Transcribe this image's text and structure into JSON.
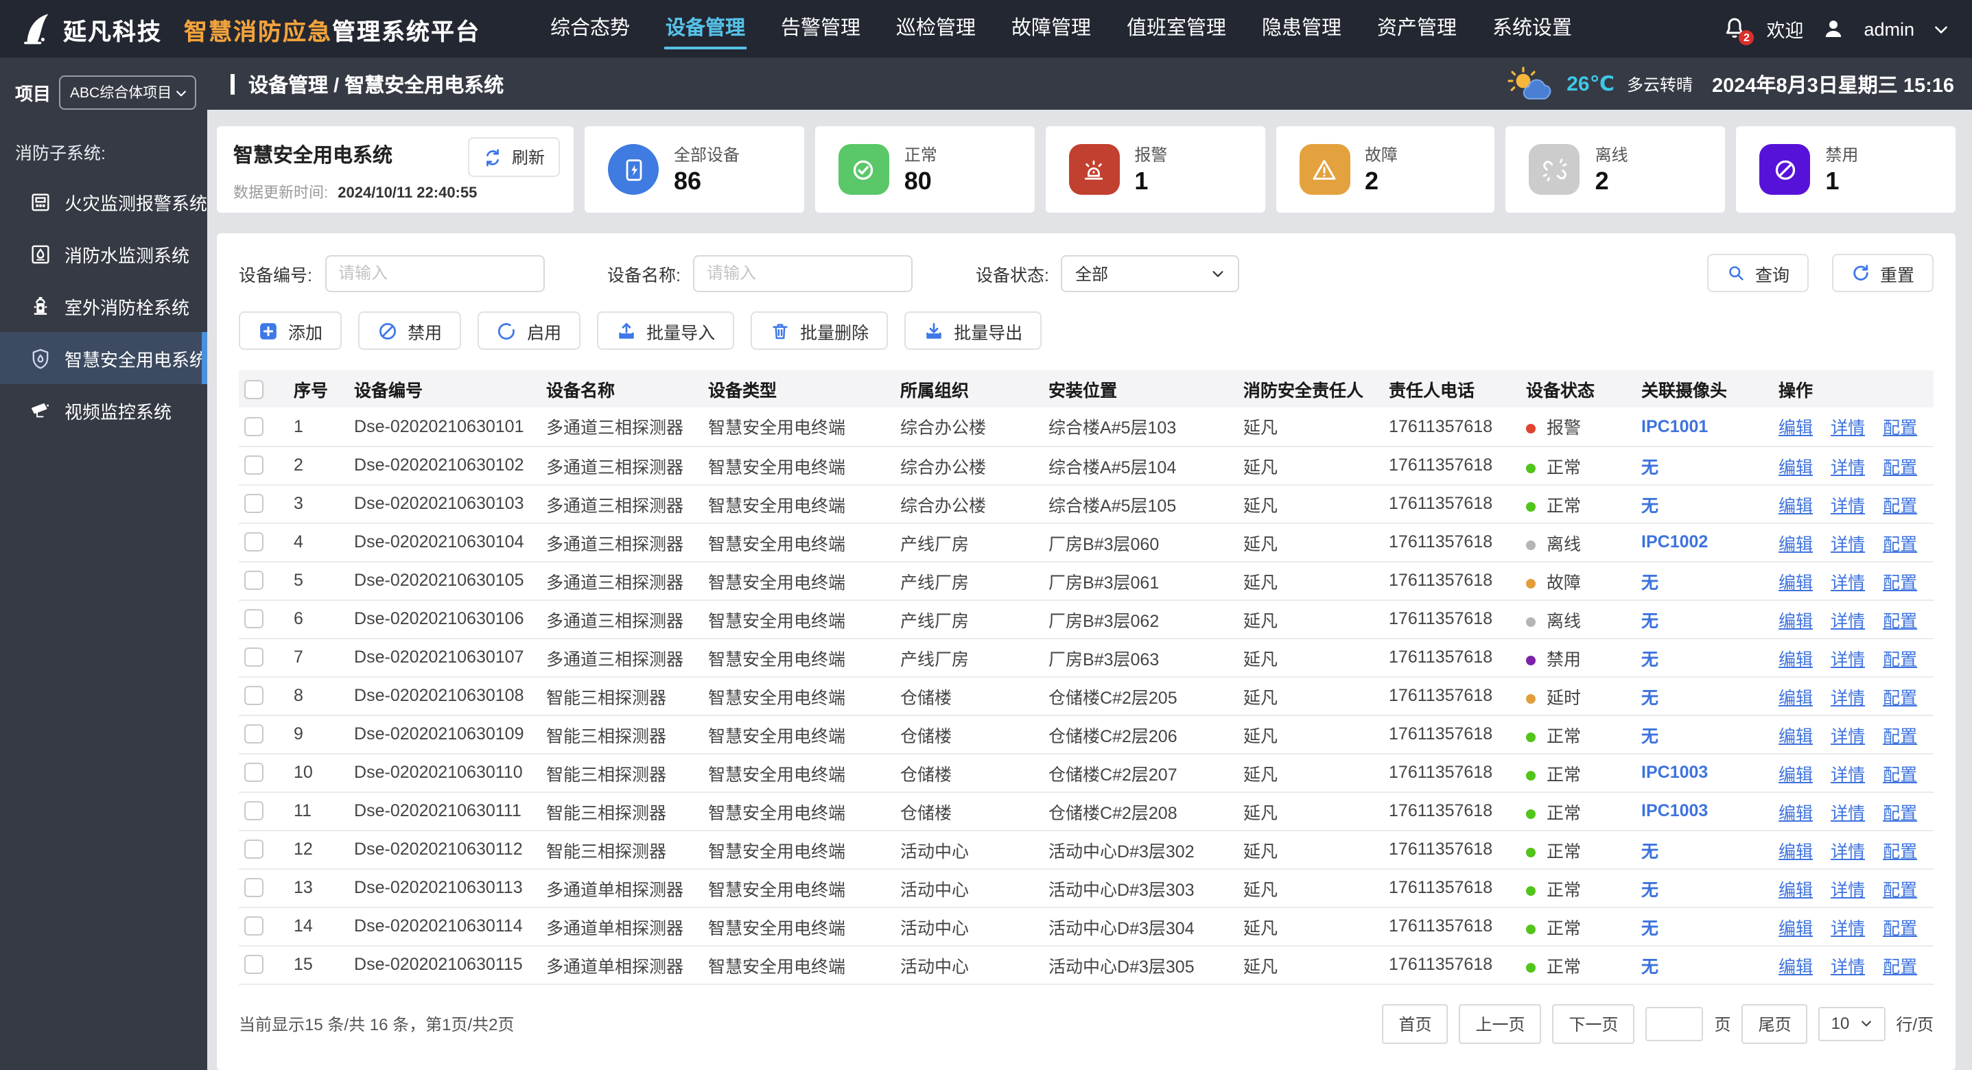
{
  "colors": {
    "accent_blue": "#3e78e7",
    "nav_active_cyan": "#56c1e8",
    "brand_orange": "#f2a33c",
    "temp_cyan": "#3ec8e6",
    "sidebar_active_bar": "#4a90dc"
  },
  "brand": {
    "company": "延凡科技",
    "title_highlight": "智慧消防应急",
    "title_rest": "管理系统平台",
    "logo_icon": "sail-logo-icon"
  },
  "topnav": {
    "items": [
      {
        "label": "综合态势",
        "active": false
      },
      {
        "label": "设备管理",
        "active": true
      },
      {
        "label": "告警管理",
        "active": false
      },
      {
        "label": "巡检管理",
        "active": false
      },
      {
        "label": "故障管理",
        "active": false
      },
      {
        "label": "值班室管理",
        "active": false
      },
      {
        "label": "隐患管理",
        "active": false
      },
      {
        "label": "资产管理",
        "active": false
      },
      {
        "label": "系统设置",
        "active": false
      }
    ],
    "notification_badge": "2",
    "welcome": "欢迎",
    "username": "admin"
  },
  "sidebar": {
    "project_label": "项目",
    "project_value": "ABC综合体项目",
    "section_title": "消防子系统:",
    "items": [
      {
        "label": "火灾监测报警系统",
        "icon": "fire-alarm-panel-icon",
        "active": false
      },
      {
        "label": "消防水监测系统",
        "icon": "water-monitor-icon",
        "active": false
      },
      {
        "label": "室外消防栓系统",
        "icon": "hydrant-icon",
        "active": false
      },
      {
        "label": "智慧安全用电系统",
        "icon": "shield-flame-icon",
        "active": true
      },
      {
        "label": "视频监控系统",
        "icon": "cctv-camera-icon",
        "active": false
      }
    ]
  },
  "pageheader": {
    "breadcrumb": "设备管理 / 智慧安全用电系统",
    "temperature": "26℃",
    "weather": "多云转晴",
    "datetime": "2024年8月3日星期三 15:16"
  },
  "overview": {
    "title": "智慧安全用电系统",
    "refresh_label": "刷新",
    "updated_label": "数据更新时间:",
    "updated_value": "2024/10/11 22:40:55",
    "stats": [
      {
        "label": "全部设备",
        "value": "86",
        "color": "#3f7be0",
        "icon": "device-power-icon"
      },
      {
        "label": "正常",
        "value": "80",
        "color": "#5ac768",
        "icon": "check-circle-icon"
      },
      {
        "label": "报警",
        "value": "1",
        "color": "#c2402f",
        "icon": "alarm-light-icon"
      },
      {
        "label": "故障",
        "value": "2",
        "color": "#e3a23e",
        "icon": "warning-triangle-icon"
      },
      {
        "label": "离线",
        "value": "2",
        "color": "#cccccc",
        "icon": "broken-link-icon"
      },
      {
        "label": "禁用",
        "value": "1",
        "color": "#5712d9",
        "icon": "prohibited-icon"
      }
    ]
  },
  "filters": {
    "device_no_label": "设备编号:",
    "device_no_placeholder": "请输入",
    "device_name_label": "设备名称:",
    "device_name_placeholder": "请输入",
    "status_label": "设备状态:",
    "status_value": "全部",
    "search_label": "查询",
    "reset_label": "重置"
  },
  "actions": [
    {
      "label": "添加",
      "icon": "add-icon"
    },
    {
      "label": "禁用",
      "icon": "ban-icon"
    },
    {
      "label": "启用",
      "icon": "enable-circle-icon"
    },
    {
      "label": "批量导入",
      "icon": "upload-icon"
    },
    {
      "label": "批量删除",
      "icon": "trash-icon"
    },
    {
      "label": "批量导出",
      "icon": "download-icon"
    }
  ],
  "table": {
    "columns": [
      "序号",
      "设备编号",
      "设备名称",
      "设备类型",
      "所属组织",
      "安装位置",
      "消防安全责任人",
      "责任人电话",
      "设备状态",
      "关联摄像头",
      "操作"
    ],
    "op_edit": "编辑",
    "op_detail": "详情",
    "op_config": "配置",
    "rows": [
      {
        "no": "1",
        "code": "Dse-02020210630101",
        "name": "多通道三相探测器",
        "type": "智慧安全用电终端",
        "org": "综合办公楼",
        "location": "综合楼A#5层103",
        "person": "延凡",
        "phone": "17611357618",
        "status": "报警",
        "status_color": "#e0432e",
        "camera": "IPC1001"
      },
      {
        "no": "2",
        "code": "Dse-02020210630102",
        "name": "多通道三相探测器",
        "type": "智慧安全用电终端",
        "org": "综合办公楼",
        "location": "综合楼A#5层104",
        "person": "延凡",
        "phone": "17611357618",
        "status": "正常",
        "status_color": "#52c41a",
        "camera": "无"
      },
      {
        "no": "3",
        "code": "Dse-02020210630103",
        "name": "多通道三相探测器",
        "type": "智慧安全用电终端",
        "org": "综合办公楼",
        "location": "综合楼A#5层105",
        "person": "延凡",
        "phone": "17611357618",
        "status": "正常",
        "status_color": "#52c41a",
        "camera": "无"
      },
      {
        "no": "4",
        "code": "Dse-02020210630104",
        "name": "多通道三相探测器",
        "type": "智慧安全用电终端",
        "org": "产线厂房",
        "location": "厂房B#3层060",
        "person": "延凡",
        "phone": "17611357618",
        "status": "离线",
        "status_color": "#b5b5b5",
        "camera": "IPC1002"
      },
      {
        "no": "5",
        "code": "Dse-02020210630105",
        "name": "多通道三相探测器",
        "type": "智慧安全用电终端",
        "org": "产线厂房",
        "location": "厂房B#3层061",
        "person": "延凡",
        "phone": "17611357618",
        "status": "故障",
        "status_color": "#e29e3d",
        "camera": "无"
      },
      {
        "no": "6",
        "code": "Dse-02020210630106",
        "name": "多通道三相探测器",
        "type": "智慧安全用电终端",
        "org": "产线厂房",
        "location": "厂房B#3层062",
        "person": "延凡",
        "phone": "17611357618",
        "status": "离线",
        "status_color": "#b5b5b5",
        "camera": "无"
      },
      {
        "no": "7",
        "code": "Dse-02020210630107",
        "name": "多通道三相探测器",
        "type": "智慧安全用电终端",
        "org": "产线厂房",
        "location": "厂房B#3层063",
        "person": "延凡",
        "phone": "17611357618",
        "status": "禁用",
        "status_color": "#7e22a8",
        "camera": "无"
      },
      {
        "no": "8",
        "code": "Dse-02020210630108",
        "name": "智能三相探测器",
        "type": "智慧安全用电终端",
        "org": "仓储楼",
        "location": "仓储楼C#2层205",
        "person": "延凡",
        "phone": "17611357618",
        "status": "延时",
        "status_color": "#e29e3d",
        "camera": "无"
      },
      {
        "no": "9",
        "code": "Dse-02020210630109",
        "name": "智能三相探测器",
        "type": "智慧安全用电终端",
        "org": "仓储楼",
        "location": "仓储楼C#2层206",
        "person": "延凡",
        "phone": "17611357618",
        "status": "正常",
        "status_color": "#52c41a",
        "camera": "无"
      },
      {
        "no": "10",
        "code": "Dse-02020210630110",
        "name": "智能三相探测器",
        "type": "智慧安全用电终端",
        "org": "仓储楼",
        "location": "仓储楼C#2层207",
        "person": "延凡",
        "phone": "17611357618",
        "status": "正常",
        "status_color": "#52c41a",
        "camera": "IPC1003"
      },
      {
        "no": "11",
        "code": "Dse-02020210630111",
        "name": "智能三相探测器",
        "type": "智慧安全用电终端",
        "org": "仓储楼",
        "location": "仓储楼C#2层208",
        "person": "延凡",
        "phone": "17611357618",
        "status": "正常",
        "status_color": "#52c41a",
        "camera": "IPC1003"
      },
      {
        "no": "12",
        "code": "Dse-02020210630112",
        "name": "智能三相探测器",
        "type": "智慧安全用电终端",
        "org": "活动中心",
        "location": "活动中心D#3层302",
        "person": "延凡",
        "phone": "17611357618",
        "status": "正常",
        "status_color": "#52c41a",
        "camera": "无"
      },
      {
        "no": "13",
        "code": "Dse-02020210630113",
        "name": "多通道单相探测器",
        "type": "智慧安全用电终端",
        "org": "活动中心",
        "location": "活动中心D#3层303",
        "person": "延凡",
        "phone": "17611357618",
        "status": "正常",
        "status_color": "#52c41a",
        "camera": "无"
      },
      {
        "no": "14",
        "code": "Dse-02020210630114",
        "name": "多通道单相探测器",
        "type": "智慧安全用电终端",
        "org": "活动中心",
        "location": "活动中心D#3层304",
        "person": "延凡",
        "phone": "17611357618",
        "status": "正常",
        "status_color": "#52c41a",
        "camera": "无"
      },
      {
        "no": "15",
        "code": "Dse-02020210630115",
        "name": "多通道单相探测器",
        "type": "智慧安全用电终端",
        "org": "活动中心",
        "location": "活动中心D#3层305",
        "person": "延凡",
        "phone": "17611357618",
        "status": "正常",
        "status_color": "#52c41a",
        "camera": "无"
      }
    ]
  },
  "pagination": {
    "summary": "当前显示15 条/共 16 条，第1页/共2页",
    "first": "首页",
    "prev": "上一页",
    "next": "下一页",
    "page_suffix": "页",
    "last": "尾页",
    "page_size": "10",
    "rows_suffix": "行/页"
  }
}
